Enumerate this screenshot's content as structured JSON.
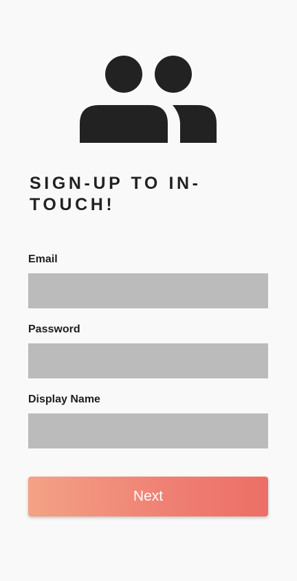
{
  "app": {
    "title": "SIGN-UP TO IN-TOUCH!",
    "logo_icon": "people-icon"
  },
  "form": {
    "email": {
      "label": "Email",
      "value": "",
      "placeholder": ""
    },
    "password": {
      "label": "Password",
      "value": "",
      "placeholder": ""
    },
    "display_name": {
      "label": "Display Name",
      "value": "",
      "placeholder": ""
    }
  },
  "actions": {
    "next_label": "Next"
  },
  "colors": {
    "background": "#f9f9f9",
    "input_fill": "#bbbbbb",
    "button_gradient_start": "#f3a286",
    "button_gradient_end": "#ec6f66",
    "icon": "#222222"
  }
}
